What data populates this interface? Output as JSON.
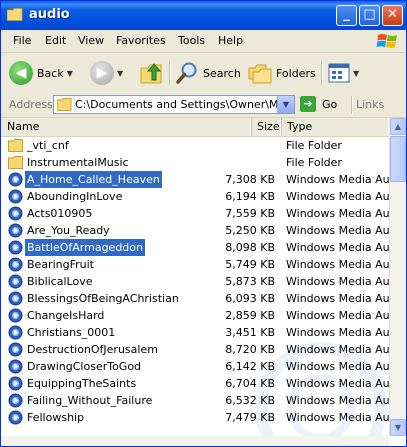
{
  "window": {
    "title": "audio",
    "controls": {
      "minimize": "_",
      "maximize": "□",
      "close": "✕"
    }
  },
  "menu": [
    "File",
    "Edit",
    "View",
    "Favorites",
    "Tools",
    "Help"
  ],
  "toolbar": {
    "back_label": "Back",
    "search_label": "Search",
    "folders_label": "Folders"
  },
  "address": {
    "label": "Address",
    "value": "C:\\Documents and Settings\\Owner\\My Documents\\audio",
    "go_label": "Go",
    "links_label": "Links"
  },
  "columns": {
    "name": "Name",
    "size": "Size",
    "type": "Type"
  },
  "files": [
    {
      "name": "_vti_cnf",
      "size": "",
      "type": "File Folder",
      "kind": "folder",
      "selected": false
    },
    {
      "name": "InstrumentalMusic",
      "size": "",
      "type": "File Folder",
      "kind": "folder",
      "selected": false
    },
    {
      "name": "A_Home_Called_Heaven",
      "size": "7,308 KB",
      "type": "Windows Media Aud...",
      "kind": "audio",
      "selected": true
    },
    {
      "name": "AboundingInLove",
      "size": "6,194 KB",
      "type": "Windows Media Aud...",
      "kind": "audio",
      "selected": false
    },
    {
      "name": "Acts010905",
      "size": "7,559 KB",
      "type": "Windows Media Aud...",
      "kind": "audio",
      "selected": false
    },
    {
      "name": "Are_You_Ready",
      "size": "5,250 KB",
      "type": "Windows Media Aud...",
      "kind": "audio",
      "selected": false
    },
    {
      "name": "BattleOfArmageddon",
      "size": "8,098 KB",
      "type": "Windows Media Aud...",
      "kind": "audio",
      "selected": true
    },
    {
      "name": "BearingFruit",
      "size": "5,749 KB",
      "type": "Windows Media Aud...",
      "kind": "audio",
      "selected": false
    },
    {
      "name": "BiblicalLove",
      "size": "5,873 KB",
      "type": "Windows Media Aud...",
      "kind": "audio",
      "selected": false
    },
    {
      "name": "BlessingsOfBeingAChristian",
      "size": "6,093 KB",
      "type": "Windows Media Aud...",
      "kind": "audio",
      "selected": false
    },
    {
      "name": "ChangeIsHard",
      "size": "2,859 KB",
      "type": "Windows Media Aud...",
      "kind": "audio",
      "selected": false
    },
    {
      "name": "Christians_0001",
      "size": "3,451 KB",
      "type": "Windows Media Aud...",
      "kind": "audio",
      "selected": false
    },
    {
      "name": "DestructionOfJerusalem",
      "size": "8,720 KB",
      "type": "Windows Media Aud...",
      "kind": "audio",
      "selected": false
    },
    {
      "name": "DrawingCloserToGod",
      "size": "6,142 KB",
      "type": "Windows Media Aud...",
      "kind": "audio",
      "selected": false
    },
    {
      "name": "EquippingTheSaints",
      "size": "6,704 KB",
      "type": "Windows Media Aud...",
      "kind": "audio",
      "selected": false
    },
    {
      "name": "Failing_Without_Failure",
      "size": "6,532 KB",
      "type": "Windows Media Aud...",
      "kind": "audio",
      "selected": false
    },
    {
      "name": "Fellowship",
      "size": "7,479 KB",
      "type": "Windows Media Aud...",
      "kind": "audio",
      "selected": false
    }
  ],
  "colors": {
    "titlebar": "#0054e3",
    "selection": "#316ac5",
    "window_bg": "#ece9d8"
  }
}
